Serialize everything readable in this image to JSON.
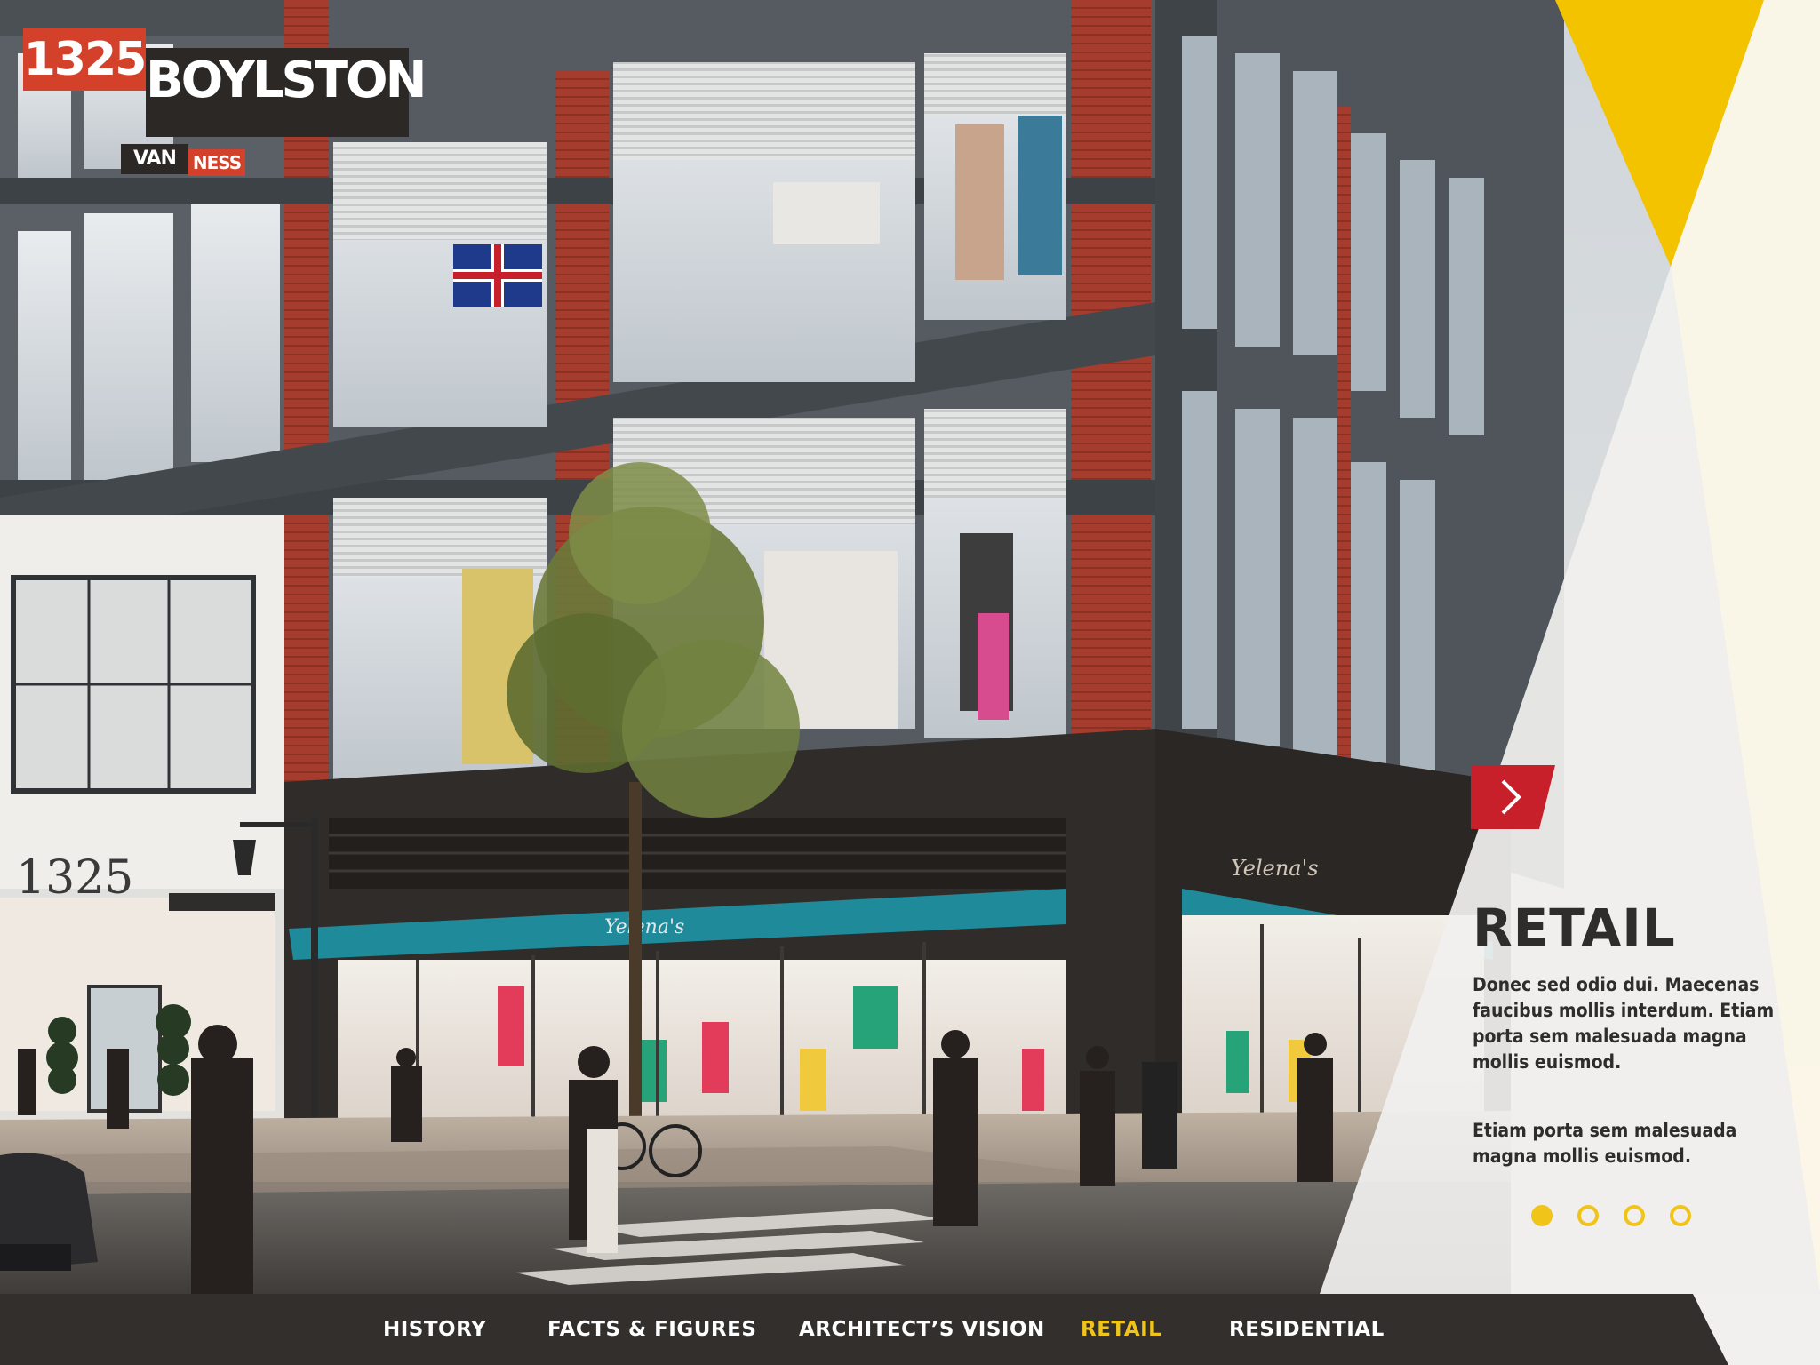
{
  "brand": {
    "number": "1325",
    "street": "BOYLSTON",
    "developer_a": "VAN",
    "developer_b": "NESS"
  },
  "scene": {
    "building_address_sign": "1325",
    "awning_text": "Yelena's",
    "store_sign": "Yelena's",
    "description": "Architectural rendering of a mixed-use building corner with retail storefronts and pedestrians"
  },
  "panel": {
    "title": "RETAIL",
    "paragraph_1": "Donec sed odio dui. Maecenas faucibus mollis interdum. Etiam porta sem malesuada magna mollis euismod.",
    "paragraph_2": "Etiam porta sem malesuada magna mollis euismod.",
    "next_icon": "chevron-right-icon",
    "slides": [
      {
        "active": true
      },
      {
        "active": false
      },
      {
        "active": false
      },
      {
        "active": false
      }
    ]
  },
  "nav": {
    "items": [
      {
        "label": "HISTORY",
        "active": false
      },
      {
        "label": "FACTS & FIGURES",
        "active": false
      },
      {
        "label": "ARCHITECT’S VISION",
        "active": false
      },
      {
        "label": "RETAIL",
        "active": true
      },
      {
        "label": "RESIDENTIAL",
        "active": false
      }
    ]
  },
  "colors": {
    "brand_red": "#d4412a",
    "accent_yellow": "#f0c419",
    "dark": "#322f2c",
    "brick": "#9c3a2c"
  }
}
